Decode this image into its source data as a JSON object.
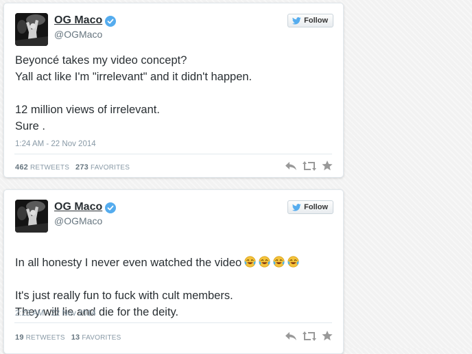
{
  "tweets": [
    {
      "user_name": "OG Maco",
      "handle": "@OGMaco",
      "follow_label": "Follow",
      "text": "Beyoncé takes my video concept?\nYall act like I'm \"irrelevant\" and it didn't happen.\n\n12 million views of irrelevant.\nSure .",
      "timestamp": "1:24 AM - 22 Nov 2014",
      "retweets": "462",
      "retweets_label": "RETWEETS",
      "favorites": "273",
      "favorites_label": "FAVORITES"
    },
    {
      "user_name": "OG Maco",
      "handle": "@OGMaco",
      "follow_label": "Follow",
      "text_line1": "In all honesty I never even watched the video",
      "text_rest": "It's just really fun to fuck with cult members.\nThey will lie and die for the deity.",
      "emoji": "face-with-tears-of-joy x4",
      "timestamp": "2:23 AM - 22 Nov 2014",
      "retweets": "19",
      "retweets_label": "RETWEETS",
      "favorites": "13",
      "favorites_label": "FAVORITES"
    }
  ],
  "icons": [
    "verified-icon",
    "twitter-bird-icon",
    "reply-icon",
    "retweet-icon",
    "favorite-icon"
  ],
  "colors": {
    "verified": "#55acee",
    "bird": "#55acee",
    "action_icons": "#999999",
    "timestamp": "#8899a6"
  }
}
